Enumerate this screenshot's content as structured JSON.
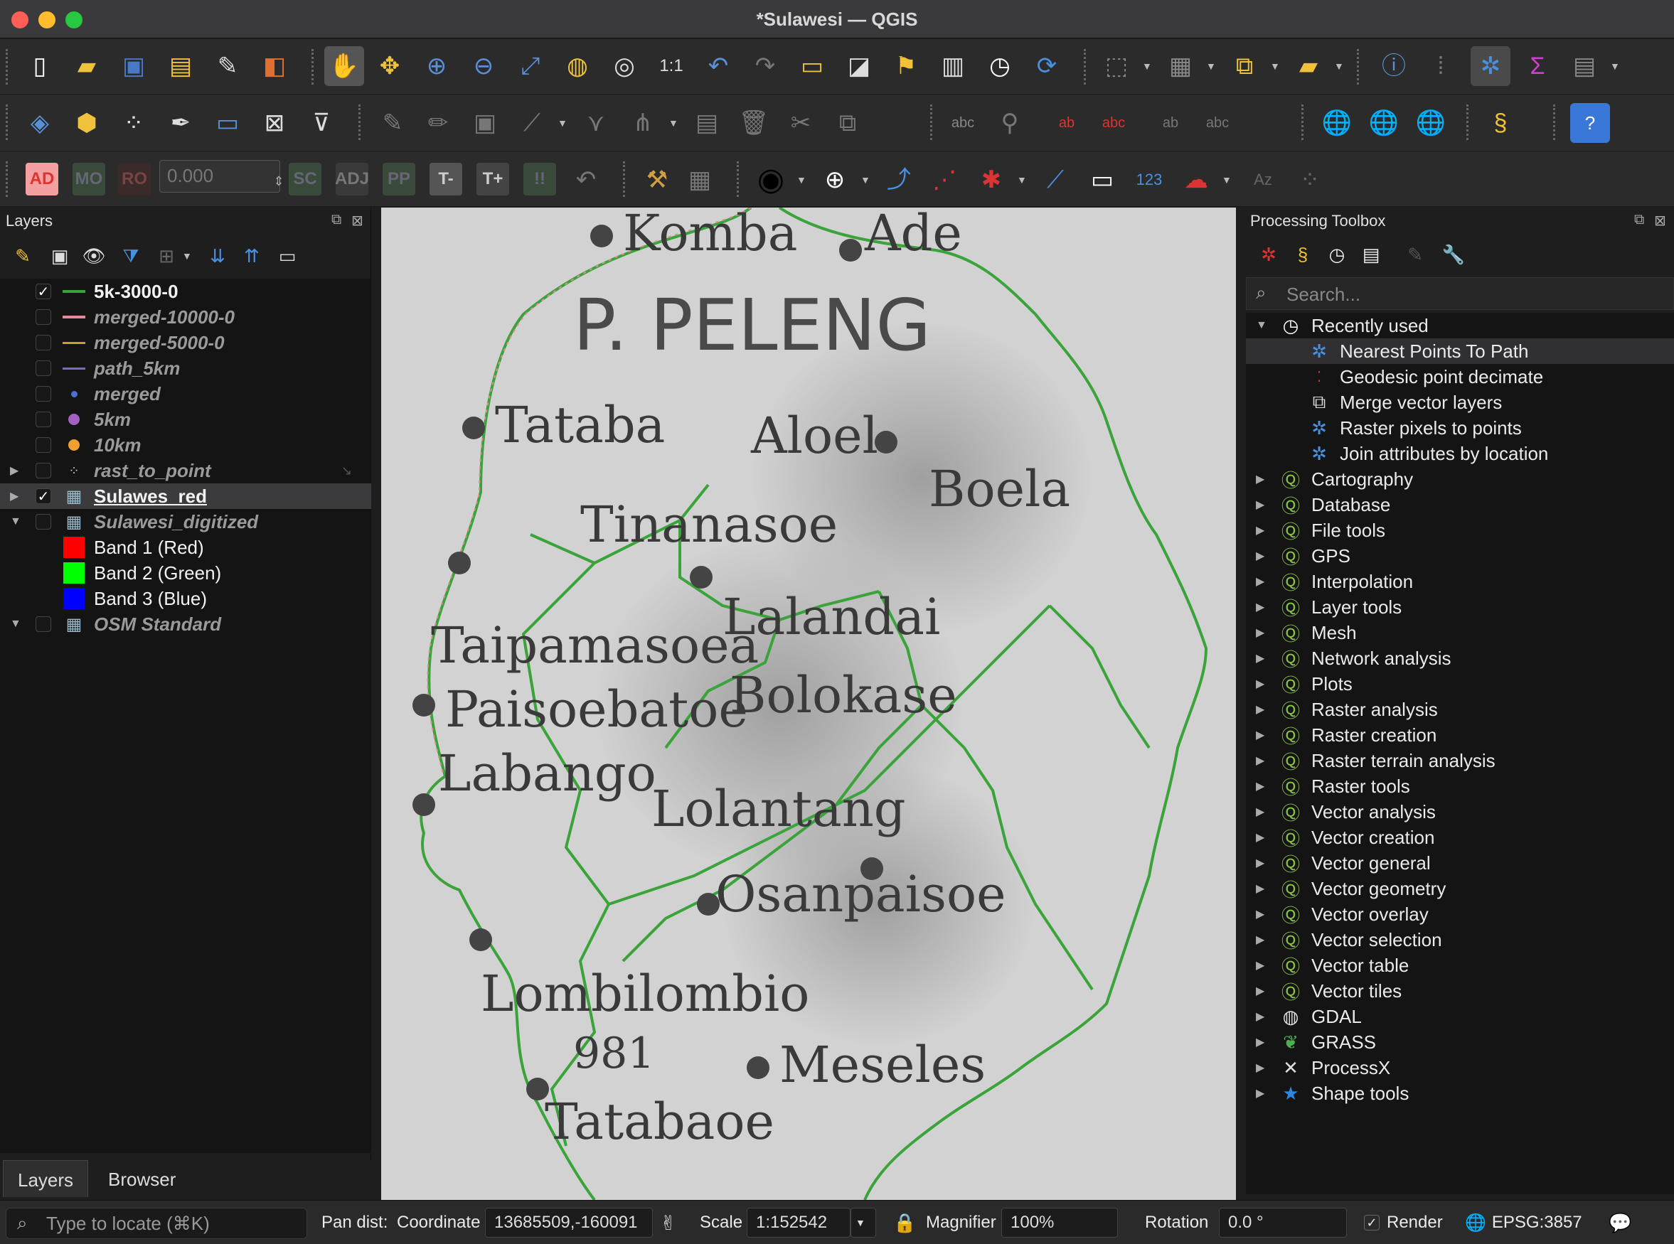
{
  "window": {
    "title": "*Sulawesi — QGIS"
  },
  "toolbar_row3": {
    "numeric_value": "0.000"
  },
  "layers_panel": {
    "title": "Layers",
    "layers": [
      {
        "name": "5k-3000-0",
        "checked": true,
        "style": "on",
        "symbol": "line",
        "color": "#3aa33a"
      },
      {
        "name": "merged-10000-0",
        "checked": false,
        "style": "off",
        "symbol": "line",
        "color": "#e38a9a"
      },
      {
        "name": "merged-5000-0",
        "checked": false,
        "style": "off",
        "symbol": "line",
        "color": "#c9a227"
      },
      {
        "name": "path_5km",
        "checked": false,
        "style": "off",
        "symbol": "line",
        "color": "#7d6ac4"
      },
      {
        "name": "merged",
        "checked": false,
        "style": "off",
        "symbol": "dot-small",
        "color": "#4d6fd0"
      },
      {
        "name": "5km",
        "checked": false,
        "style": "off",
        "symbol": "dot",
        "color": "#a35fc2"
      },
      {
        "name": "10km",
        "checked": false,
        "style": "off",
        "symbol": "dot",
        "color": "#f0a030"
      },
      {
        "name": "rast_to_point",
        "checked": false,
        "style": "off",
        "symbol": "points",
        "expand": "collapsed"
      },
      {
        "name": "Sulawes_red",
        "checked": true,
        "style": "on-ul",
        "symbol": "raster",
        "expand": "collapsed",
        "selected": true
      },
      {
        "name": "Sulawesi_digitized",
        "checked": false,
        "style": "off",
        "symbol": "raster",
        "expand": "expanded"
      },
      {
        "name": "Band 1 (Red)",
        "style": "band",
        "symbol": "swatch",
        "color": "#ff0000"
      },
      {
        "name": "Band 2 (Green)",
        "style": "band",
        "symbol": "swatch",
        "color": "#00ff00"
      },
      {
        "name": "Band 3 (Blue)",
        "style": "band",
        "symbol": "swatch",
        "color": "#0000ff"
      },
      {
        "name": "OSM Standard",
        "checked": false,
        "style": "off",
        "symbol": "raster",
        "expand": "expanded"
      }
    ],
    "tabs": [
      "Layers",
      "Browser"
    ]
  },
  "map": {
    "labels": [
      {
        "text": "Komba",
        "size": 70
      },
      {
        "text": "Ade",
        "size": 70
      },
      {
        "text": "P. PELENG",
        "size": 100
      },
      {
        "text": "Tataba",
        "size": 70
      },
      {
        "text": "Aloel",
        "size": 70
      },
      {
        "text": "Tinanasoe",
        "size": 70
      },
      {
        "text": "Boela",
        "size": 70
      },
      {
        "text": "Lalandai",
        "size": 70
      },
      {
        "text": "Taipamasoea",
        "size": 70
      },
      {
        "text": "Paisoebatoe",
        "size": 70
      },
      {
        "text": "Bolokase",
        "size": 70
      },
      {
        "text": "Labango",
        "size": 70
      },
      {
        "text": "Lolantang",
        "size": 70
      },
      {
        "text": "Osanpaisoe",
        "size": 70
      },
      {
        "text": "Lombilombio",
        "size": 70
      },
      {
        "text": "981",
        "size": 60
      },
      {
        "text": "Meseles",
        "size": 70
      },
      {
        "text": "Tatabaoe",
        "size": 70
      }
    ]
  },
  "toolbox": {
    "title": "Processing Toolbox",
    "search_placeholder": "Search...",
    "recently_used_label": "Recently used",
    "recent": [
      {
        "label": "Nearest Points To Path",
        "icon": "gear-icon"
      },
      {
        "label": "Geodesic point decimate",
        "icon": "points-icon"
      },
      {
        "label": "Merge vector layers",
        "icon": "merge-icon"
      },
      {
        "label": "Raster pixels to points",
        "icon": "gear-icon"
      },
      {
        "label": "Join attributes by location",
        "icon": "gear-icon"
      }
    ],
    "providers": [
      {
        "label": "Cartography",
        "icon": "qgis-icon"
      },
      {
        "label": "Database",
        "icon": "qgis-icon"
      },
      {
        "label": "File tools",
        "icon": "qgis-icon"
      },
      {
        "label": "GPS",
        "icon": "qgis-icon"
      },
      {
        "label": "Interpolation",
        "icon": "qgis-icon"
      },
      {
        "label": "Layer tools",
        "icon": "qgis-icon"
      },
      {
        "label": "Mesh",
        "icon": "qgis-icon"
      },
      {
        "label": "Network analysis",
        "icon": "qgis-icon"
      },
      {
        "label": "Plots",
        "icon": "qgis-icon"
      },
      {
        "label": "Raster analysis",
        "icon": "qgis-icon"
      },
      {
        "label": "Raster creation",
        "icon": "qgis-icon"
      },
      {
        "label": "Raster terrain analysis",
        "icon": "qgis-icon"
      },
      {
        "label": "Raster tools",
        "icon": "qgis-icon"
      },
      {
        "label": "Vector analysis",
        "icon": "qgis-icon"
      },
      {
        "label": "Vector creation",
        "icon": "qgis-icon"
      },
      {
        "label": "Vector general",
        "icon": "qgis-icon"
      },
      {
        "label": "Vector geometry",
        "icon": "qgis-icon"
      },
      {
        "label": "Vector overlay",
        "icon": "qgis-icon"
      },
      {
        "label": "Vector selection",
        "icon": "qgis-icon"
      },
      {
        "label": "Vector table",
        "icon": "qgis-icon"
      },
      {
        "label": "Vector tiles",
        "icon": "qgis-icon"
      },
      {
        "label": "GDAL",
        "icon": "gdal-icon"
      },
      {
        "label": "GRASS",
        "icon": "grass-icon"
      },
      {
        "label": "ProcessX",
        "icon": "processx-icon"
      },
      {
        "label": "Shape tools",
        "icon": "star-icon"
      }
    ]
  },
  "statusbar": {
    "locator_placeholder": "Type to locate (⌘K)",
    "pan_label": "Pan dist:",
    "coordinate_label": "Coordinate",
    "coordinate_value": "13685509,-160091",
    "scale_label": "Scale",
    "scale_value": "1:152542",
    "magnifier_label": "Magnifier",
    "magnifier_value": "100%",
    "rotation_label": "Rotation",
    "rotation_value": "0.0 °",
    "render_label": "Render",
    "crs_label": "EPSG:3857"
  },
  "colors": {
    "accent": "#3a78d8",
    "coast_line": "#3aa33a",
    "dotted_red": "#e38a9a"
  }
}
